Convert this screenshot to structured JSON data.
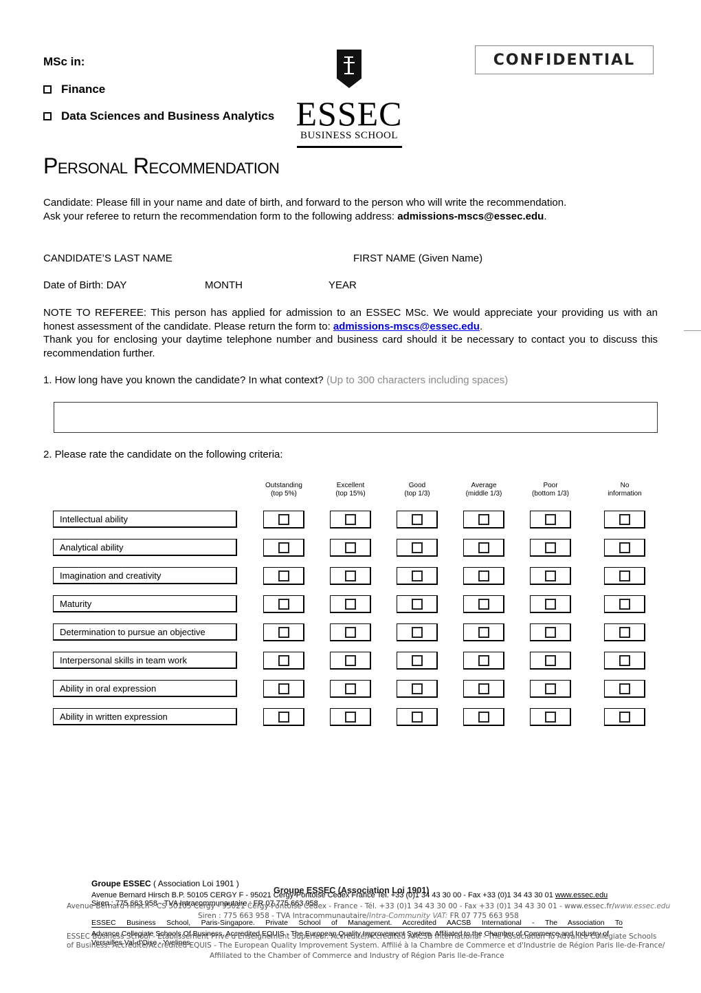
{
  "header": {
    "msc_label": "MSc in:",
    "programs": [
      {
        "label": "Finance",
        "checked": false
      },
      {
        "label": "Data Sciences and Business Analytics",
        "checked": false
      }
    ],
    "confidential": "CONFIDENTIAL",
    "logo": {
      "shield_letter": "E",
      "wordmark": "ESSEC",
      "subtitle": "BUSINESS SCHOOL"
    }
  },
  "title": "Personal Recommendation",
  "intro": {
    "line1": "Candidate: Please fill in your name and date of birth, and forward to the person who will write the recommendation.",
    "line2_prefix": "Ask your referee to return the recommendation form to the following address: ",
    "line2_email": "admissions-mscs@essec.edu",
    "line2_suffix": "."
  },
  "candidate": {
    "last_name_label": "CANDIDATE’S LAST NAME",
    "first_name_label": "FIRST NAME (Given Name)",
    "dob_label": "Date of Birth: DAY",
    "month_label": "MONTH",
    "year_label": "YEAR"
  },
  "note": {
    "text1": "NOTE TO REFEREE: This person has applied for admission to an ESSEC MSc. We would appreciate your providing us with an honest assessment of the candidate. Please return the form to: ",
    "email": "admissions-mscs@essec.edu",
    "text1_suffix": ".",
    "text2": "Thank you for enclosing your daytime telephone number and business card should it be necessary to contact you to discuss this recommendation further."
  },
  "question1": {
    "label": "1. How long have you known the candidate? In what context? ",
    "hint": "(Up to 300 characters including spaces)",
    "value": ""
  },
  "question2": {
    "label": "2. Please rate the candidate on the following criteria:",
    "columns": [
      {
        "title": "Outstanding",
        "sub": "(top 5%)"
      },
      {
        "title": "Excellent",
        "sub": "(top 15%)"
      },
      {
        "title": "Good",
        "sub": "(top 1/3)"
      },
      {
        "title": "Average",
        "sub": "(middle 1/3)"
      },
      {
        "title": "Poor",
        "sub": "(bottom 1/3)"
      },
      {
        "title": "No",
        "sub": "information"
      }
    ],
    "criteria": [
      "Intellectual ability",
      "Analytical ability",
      "Imagination and creativity",
      "Maturity",
      "Determination to pursue an objective",
      "Interpersonal skills in team work",
      "Ability in oral expression",
      "Ability in written expression"
    ]
  },
  "footer": {
    "group_bold": "Groupe ESSEC",
    "group_rest": " ( Association Loi 1901 )",
    "address1": "Avenue Bernard Hirsch B.P. 50105 CERGY F - 95021 Cergy-Pontoise Cedex France Tel. +33 (0)1 34 43 30 00 - Fax +33 (0)1 34 43 30 01 ",
    "website1": "www.essec.edu",
    "siren1": "Siren : 775 663 958 - TVA Intracommunautaire : FR 07 775 663 958",
    "overlap_group": "Groupe ESSEC (Association Loi 1901)",
    "address2": "Avenue Bernard Hirsch - CS 50105 Cergy - 95021 Cergy-Pontoise Cedex - France - Tél. +33 (0)1 34 43 30 00 - Fax +33 (0)1 34 43 30 01 - www.essec.fr/",
    "website2_italic": "www.essec.edu",
    "siren2": "Siren : 775 663 958 - TVA Intracommunautaire/",
    "siren2_italic": "Intra-Community VAT:",
    "siren2_end": " FR 07 775 663 958",
    "accred1": "ESSEC Business School, Paris-Singapore. Private School of Management. Accredited AACSB International - The Association To",
    "accred1b": "Advance Collegiate Schools Of Business. Accredited EQUIS - The European Quality Improvement System. Affiliated to the Chamber of Commerce and Industry of",
    "accred1c": "Versailles Val-d'Oise - Yvelines.",
    "accred2": "ESSEC Business School - Etablissement Privé d'Enseignement Supérieur. Accrédité/Accredited AACSB International - The Association To Advance Collegiate Schools",
    "accred3": "of Business. Accrédité/Accredited EQUIS - The European Quality Improvement System. Affilié à la Chambre de Commerce et d'Industrie de Région Paris Ile-de-France/",
    "accred4": "Affiliated to the Chamber of Commerce and Industry of Région Paris Ile-de-France"
  }
}
